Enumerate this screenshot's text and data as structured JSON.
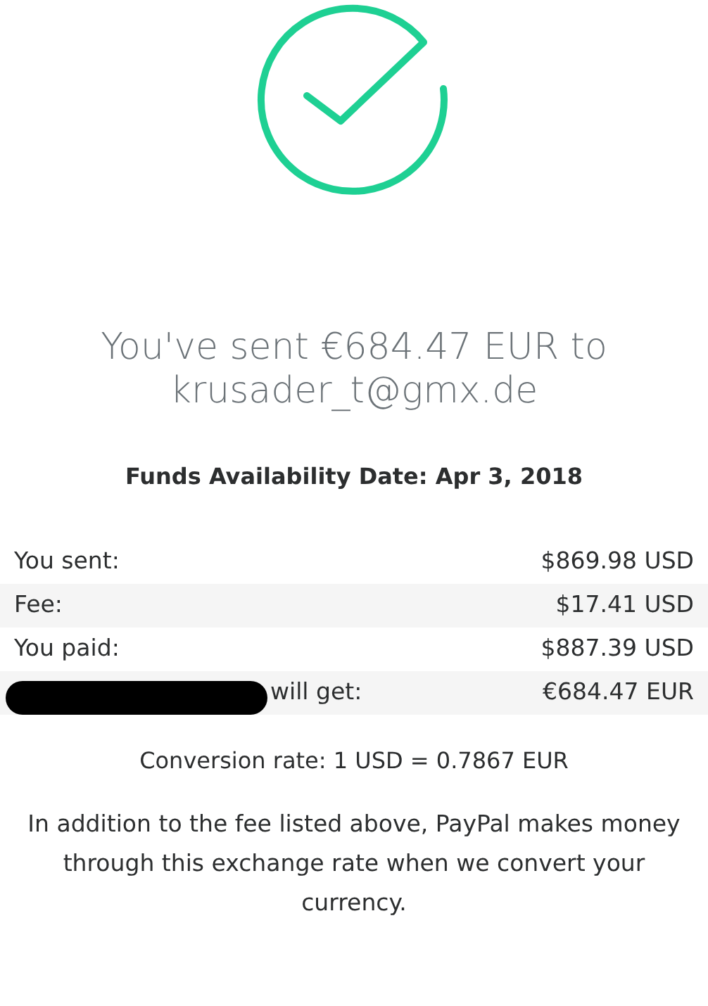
{
  "headline": "You've sent €684.47 EUR to krusader_t@gmx.de",
  "availability": "Funds Availability Date: Apr 3, 2018",
  "rows": [
    {
      "label": "You sent:",
      "value": "$869.98 USD",
      "redacted": false
    },
    {
      "label": "Fee:",
      "value": "$17.41 USD",
      "redacted": false
    },
    {
      "label": "You paid:",
      "value": "$887.39 USD",
      "redacted": false
    },
    {
      "label": "will get:",
      "value": "€684.47 EUR",
      "redacted": true
    }
  ],
  "conversion": "Conversion rate: 1 USD = 0.7867 EUR",
  "note": "In addition to the fee listed above, PayPal makes money through this exchange rate when we convert your currency."
}
